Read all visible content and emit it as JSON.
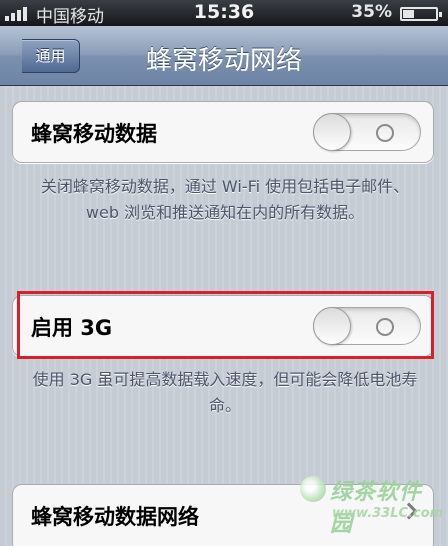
{
  "status_bar": {
    "carrier": "中国移动",
    "time": "15:36",
    "battery_percent": "35%",
    "battery_level": 0.35,
    "signal_icon": "signal-bars-icon",
    "battery_icon": "battery-icon"
  },
  "nav": {
    "back_label": "通用",
    "title": "蜂窝移动网络"
  },
  "cellular_data": {
    "label": "蜂窝移动数据",
    "toggle_state": "off",
    "footer": "关闭蜂窝移动数据，通过 Wi-Fi 使用包括电子邮件、web 浏览和推送通知在内的所有数据。"
  },
  "enable_3g": {
    "label": "启用 3G",
    "toggle_state": "off",
    "footer": "使用 3G 虽可提高数据载入速度，但可能会降低电池寿命。"
  },
  "cellular_network": {
    "label": "蜂窝移动数据网络"
  },
  "watermark": {
    "brand": "绿茶软件园",
    "url": "www.33LC.com"
  },
  "colors": {
    "highlight": "#d7202a",
    "nav_blue": "#6d84a4",
    "background": "#c5ccd4"
  }
}
